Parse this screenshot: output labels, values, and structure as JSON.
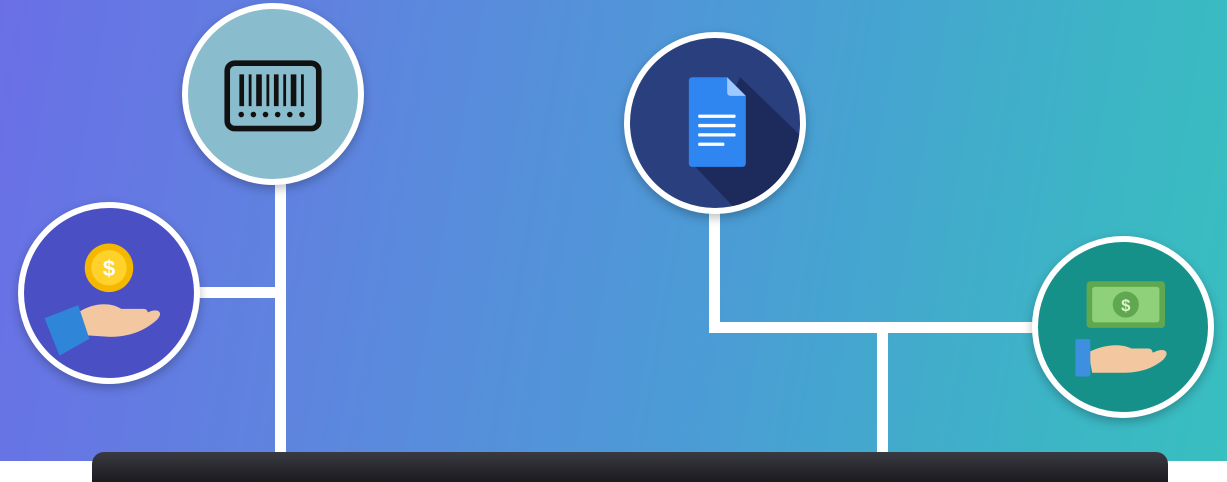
{
  "colors": {
    "connector": "#ffffff",
    "barcode_bg": "#89bccd",
    "document_bg": "#2a3f7e",
    "payment_bg": "#4a4fc4",
    "cash_bg": "#16918a",
    "bottom_bar": "#1d1d22"
  },
  "icons": [
    "barcode-icon",
    "document-icon",
    "coin-payment-icon",
    "cash-payment-icon"
  ]
}
